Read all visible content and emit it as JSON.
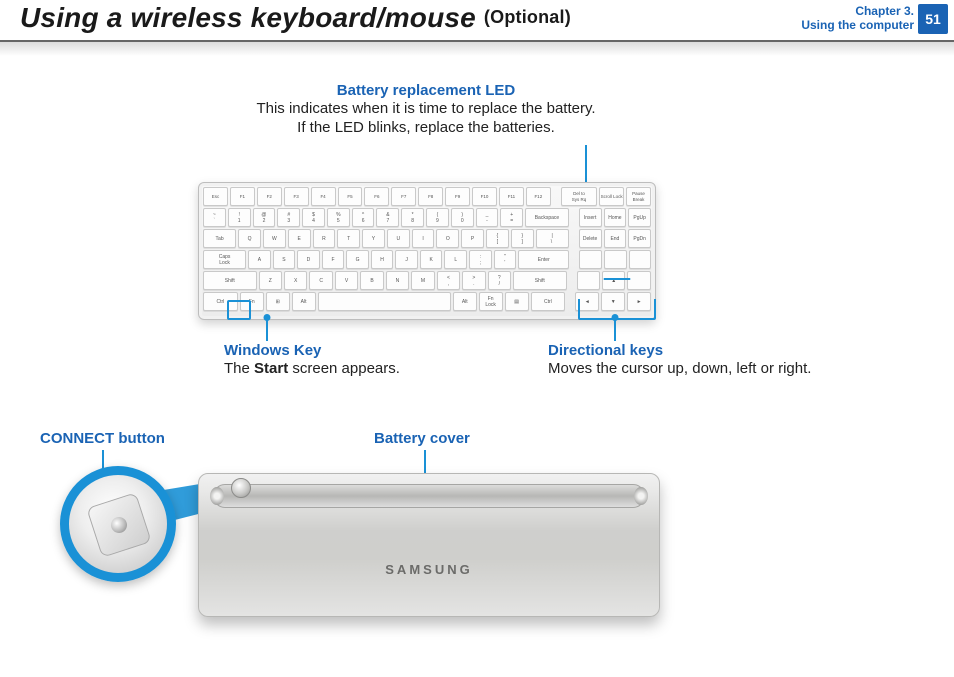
{
  "header": {
    "title_main": "Using a wireless keyboard/mouse",
    "title_suffix": "(Optional)",
    "chapter_line1": "Chapter 3.",
    "chapter_line2": "Using the computer",
    "page_number": "51"
  },
  "callouts": {
    "led": {
      "title": "Battery replacement LED",
      "line1": "This indicates when it is time to replace the battery.",
      "line2": "If the LED blinks, replace the batteries."
    },
    "win": {
      "title": "Windows Key",
      "body_pre": "The ",
      "body_bold": "Start",
      "body_post": " screen appears."
    },
    "arrows": {
      "title": "Directional keys",
      "body": "Moves the cursor up, down, left or right."
    },
    "connect": {
      "title": "CONNECT button"
    },
    "cover": {
      "title": "Battery cover"
    }
  },
  "device": {
    "brand": "SAMSUNG"
  },
  "keyboard": {
    "rows": [
      [
        {
          "l": "Esc"
        },
        {
          "l": "F1"
        },
        {
          "l": "F2"
        },
        {
          "l": "F3"
        },
        {
          "l": "F4"
        },
        {
          "l": "F5"
        },
        {
          "l": "F6"
        },
        {
          "l": "F7"
        },
        {
          "l": "F8"
        },
        {
          "l": "F9"
        },
        {
          "l": "F10"
        },
        {
          "l": "F11"
        },
        {
          "l": "F12"
        },
        {
          "gap": true
        },
        {
          "l": "Del to\nSys Rq",
          "w": "w15"
        },
        {
          "l": "Scroll Lock"
        },
        {
          "l": "Pause\nBreak"
        }
      ],
      [
        {
          "l": "~\n`"
        },
        {
          "l": "!\n1"
        },
        {
          "l": "@\n2"
        },
        {
          "l": "#\n3"
        },
        {
          "l": "$\n4"
        },
        {
          "l": "%\n5"
        },
        {
          "l": "^\n6"
        },
        {
          "l": "&\n7"
        },
        {
          "l": "*\n8"
        },
        {
          "l": "(\n9"
        },
        {
          "l": ")\n0"
        },
        {
          "l": "_\n-"
        },
        {
          "l": "+\n="
        },
        {
          "l": "Backspace",
          "w": "w20"
        },
        {
          "gap": true
        },
        {
          "l": "Insert"
        },
        {
          "l": "Home"
        },
        {
          "l": "PgUp"
        }
      ],
      [
        {
          "l": "Tab",
          "w": "w15"
        },
        {
          "l": "Q"
        },
        {
          "l": "W"
        },
        {
          "l": "E"
        },
        {
          "l": "R"
        },
        {
          "l": "T"
        },
        {
          "l": "Y"
        },
        {
          "l": "U"
        },
        {
          "l": "I"
        },
        {
          "l": "O"
        },
        {
          "l": "P"
        },
        {
          "l": "{\n["
        },
        {
          "l": "}\n]"
        },
        {
          "l": "|\n\\ ",
          "w": "w15"
        },
        {
          "gap": true
        },
        {
          "l": "Delete"
        },
        {
          "l": "End"
        },
        {
          "l": "PgDn"
        }
      ],
      [
        {
          "l": "Caps\nLock",
          "w": "w20"
        },
        {
          "l": "A"
        },
        {
          "l": "S"
        },
        {
          "l": "D"
        },
        {
          "l": "F"
        },
        {
          "l": "G"
        },
        {
          "l": "H"
        },
        {
          "l": "J"
        },
        {
          "l": "K"
        },
        {
          "l": "L"
        },
        {
          "l": ":\n;"
        },
        {
          "l": "\"\n'"
        },
        {
          "l": "Enter",
          "w": "w25"
        },
        {
          "gap": true
        },
        {
          "l": ""
        },
        {
          "l": ""
        },
        {
          "l": ""
        }
      ],
      [
        {
          "l": "Shift",
          "w": "w25"
        },
        {
          "l": "Z"
        },
        {
          "l": "X"
        },
        {
          "l": "C"
        },
        {
          "l": "V"
        },
        {
          "l": "B"
        },
        {
          "l": "N"
        },
        {
          "l": "M"
        },
        {
          "l": "<\n,"
        },
        {
          "l": ">\n."
        },
        {
          "l": "?\n/"
        },
        {
          "l": "Shift",
          "w": "w25"
        },
        {
          "gap": true
        },
        {
          "l": ""
        },
        {
          "l": "▲"
        },
        {
          "l": ""
        }
      ],
      [
        {
          "l": "Ctrl",
          "w": "w15"
        },
        {
          "l": "Fn"
        },
        {
          "l": "⊞"
        },
        {
          "l": "Alt"
        },
        {
          "l": "",
          "w": "sp"
        },
        {
          "l": "Alt"
        },
        {
          "l": "Fn\nLock"
        },
        {
          "l": "▤"
        },
        {
          "l": "Ctrl",
          "w": "w15"
        },
        {
          "gap": true
        },
        {
          "l": "◄"
        },
        {
          "l": "▼"
        },
        {
          "l": "►"
        }
      ]
    ]
  }
}
